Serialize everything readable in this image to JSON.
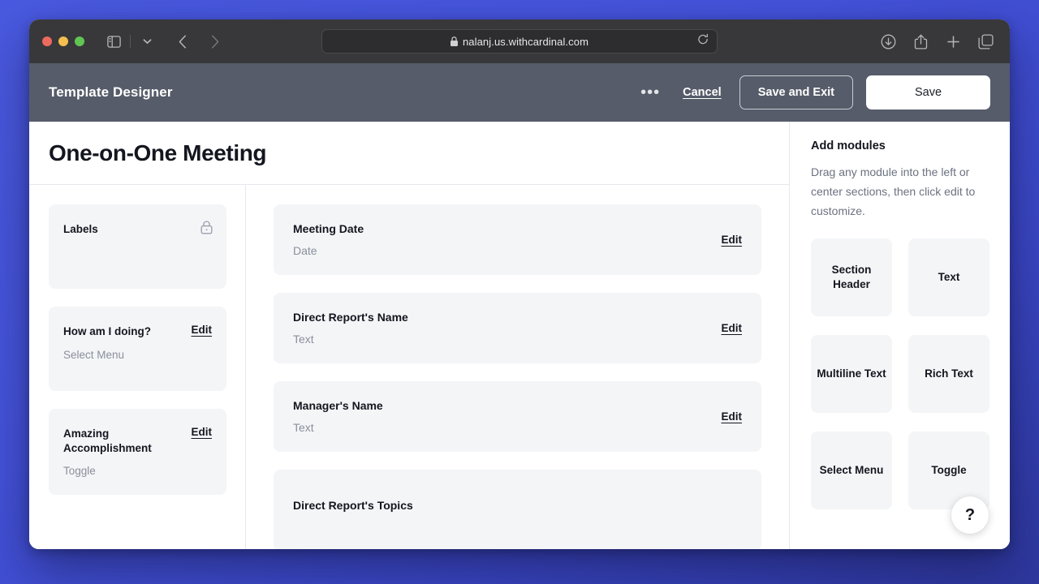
{
  "browser": {
    "url": "nalanj.us.withcardinal.com",
    "lock_icon": "lock-icon",
    "reload_icon": "reload-icon",
    "sidebar_icon": "sidebar-toggle-icon",
    "tab_overview_chevron": "chevron-down-icon",
    "back_icon": "chevron-left-icon",
    "forward_icon": "chevron-right-icon",
    "downloads_icon": "download-icon",
    "share_icon": "share-icon",
    "new_tab_icon": "plus-icon",
    "tabs_icon": "tabs-icon"
  },
  "app_header": {
    "title": "Template Designer",
    "more_label": "•••",
    "cancel_label": "Cancel",
    "save_and_exit_label": "Save and Exit",
    "save_label": "Save"
  },
  "template": {
    "title": "One-on-One Meeting"
  },
  "left_column": {
    "cards": [
      {
        "title": "Labels",
        "type": "",
        "edit_label": "",
        "locked": true
      },
      {
        "title": "How am I doing?",
        "type": "Select Menu",
        "edit_label": "Edit",
        "locked": false
      },
      {
        "title": "Amazing Accomplishment",
        "type": "Toggle",
        "edit_label": "Edit",
        "locked": false
      }
    ]
  },
  "center_column": {
    "cards": [
      {
        "title": "Meeting Date",
        "type": "Date",
        "edit_label": "Edit"
      },
      {
        "title": "Direct Report's Name",
        "type": "Text",
        "edit_label": "Edit"
      },
      {
        "title": "Manager's Name",
        "type": "Text",
        "edit_label": "Edit"
      },
      {
        "title": "Direct Report's Topics",
        "type": "",
        "edit_label": ""
      }
    ]
  },
  "modules_panel": {
    "title": "Add modules",
    "description": "Drag any module into the left or center sections, then click edit to customize.",
    "tiles": [
      {
        "label": "Section Header"
      },
      {
        "label": "Text"
      },
      {
        "label": "Multiline Text"
      },
      {
        "label": "Rich Text"
      },
      {
        "label": "Select Menu"
      },
      {
        "label": "Toggle"
      }
    ],
    "help_label": "?"
  },
  "colors": {
    "desktop": "#4453db",
    "chrome": "#38383a",
    "app_header": "#565c69",
    "card_bg": "#f4f5f7",
    "text_primary": "#14161f",
    "text_muted": "#8a8f9c"
  }
}
